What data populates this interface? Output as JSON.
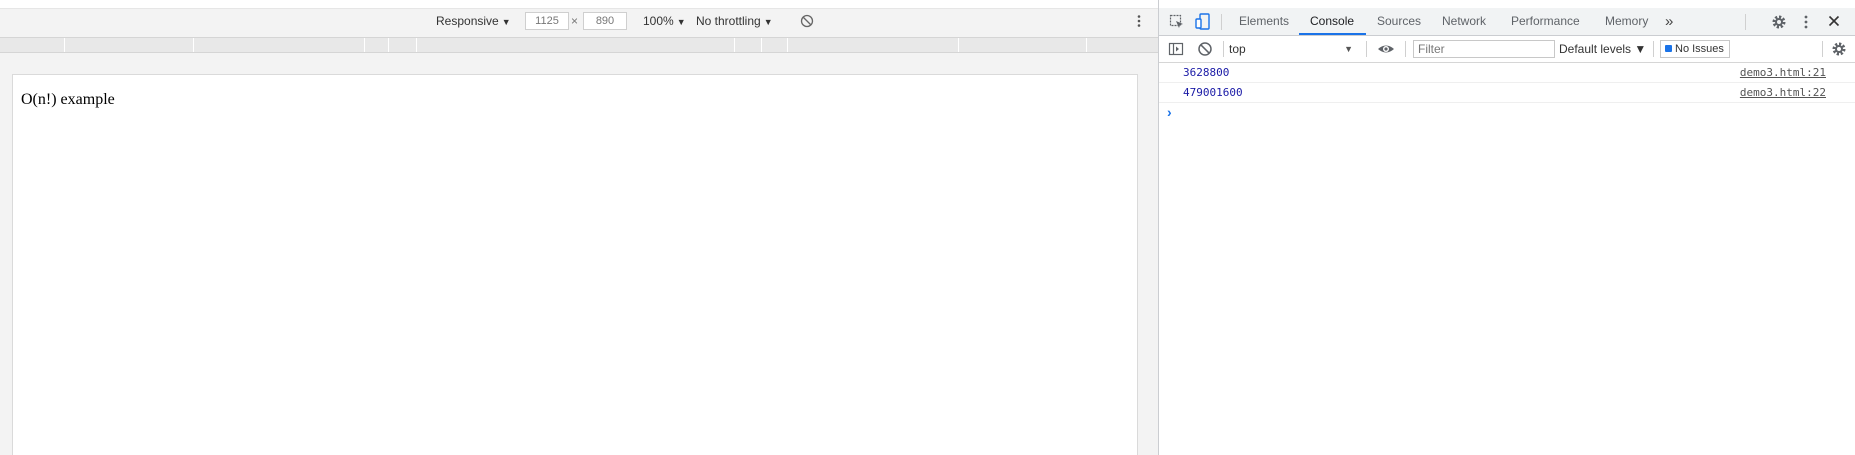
{
  "device_toolbar": {
    "device": "Responsive",
    "width": "1125",
    "height": "890",
    "times": "×",
    "zoom": "100%",
    "throttling": "No throttling",
    "arrow": "▼"
  },
  "page": {
    "text": "O(n!) example"
  },
  "devtools": {
    "tabs": [
      "Elements",
      "Console",
      "Sources",
      "Network",
      "Performance",
      "Memory"
    ],
    "active_tab": "Console",
    "more_tabs": "»",
    "console": {
      "context": "top",
      "filter_placeholder": "Filter",
      "levels": "Default levels ▼",
      "issues": "No Issues",
      "logs": [
        {
          "value": "3628800",
          "source": "demo3.html:21"
        },
        {
          "value": "479001600",
          "source": "demo3.html:22"
        }
      ],
      "prompt": "›"
    },
    "accent_color": "#1a73e8"
  }
}
